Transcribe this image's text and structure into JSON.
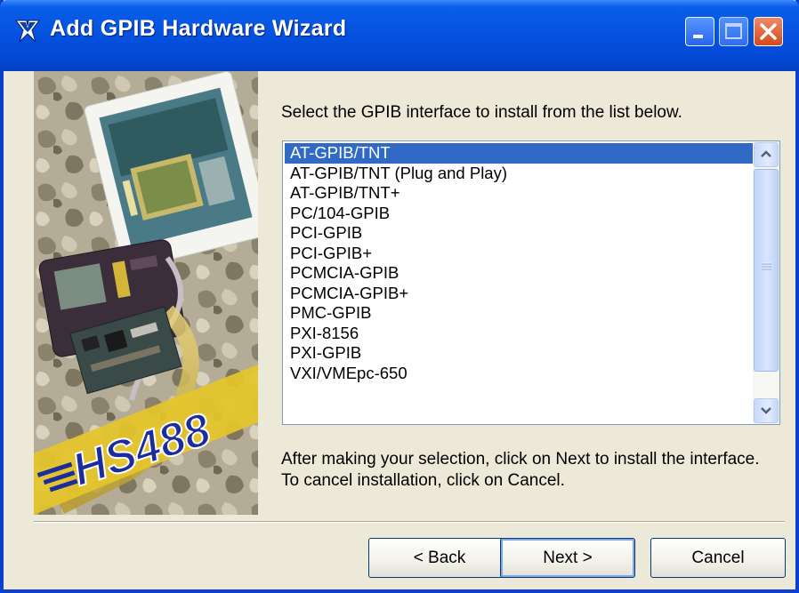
{
  "window": {
    "title": "Add GPIB Hardware Wizard"
  },
  "titlebar_icons": {
    "app": "ni-eagle-icon",
    "minimize": "minimize-icon",
    "maximize": "maximize-icon",
    "close": "close-icon"
  },
  "graphic": {
    "logo_text": "HS488"
  },
  "content": {
    "instruction": "Select the GPIB interface to install from the list below.",
    "footnote": "After making your selection, click on Next to install the interface.  To cancel installation, click on Cancel."
  },
  "interface_list": {
    "selected_index": 0,
    "items": [
      "AT-GPIB/TNT",
      "AT-GPIB/TNT (Plug and Play)",
      "AT-GPIB/TNT+",
      "PC/104-GPIB",
      "PCI-GPIB",
      "PCI-GPIB+",
      "PCMCIA-GPIB",
      "PCMCIA-GPIB+",
      "PMC-GPIB",
      "PXI-8156",
      "PXI-GPIB",
      "VXI/VMEpc-650"
    ]
  },
  "buttons": {
    "back": "< Back",
    "next": "Next >",
    "cancel": "Cancel"
  },
  "colors": {
    "titlebar": "#0553e0",
    "selection": "#316ac5",
    "face": "#ece9d8"
  }
}
